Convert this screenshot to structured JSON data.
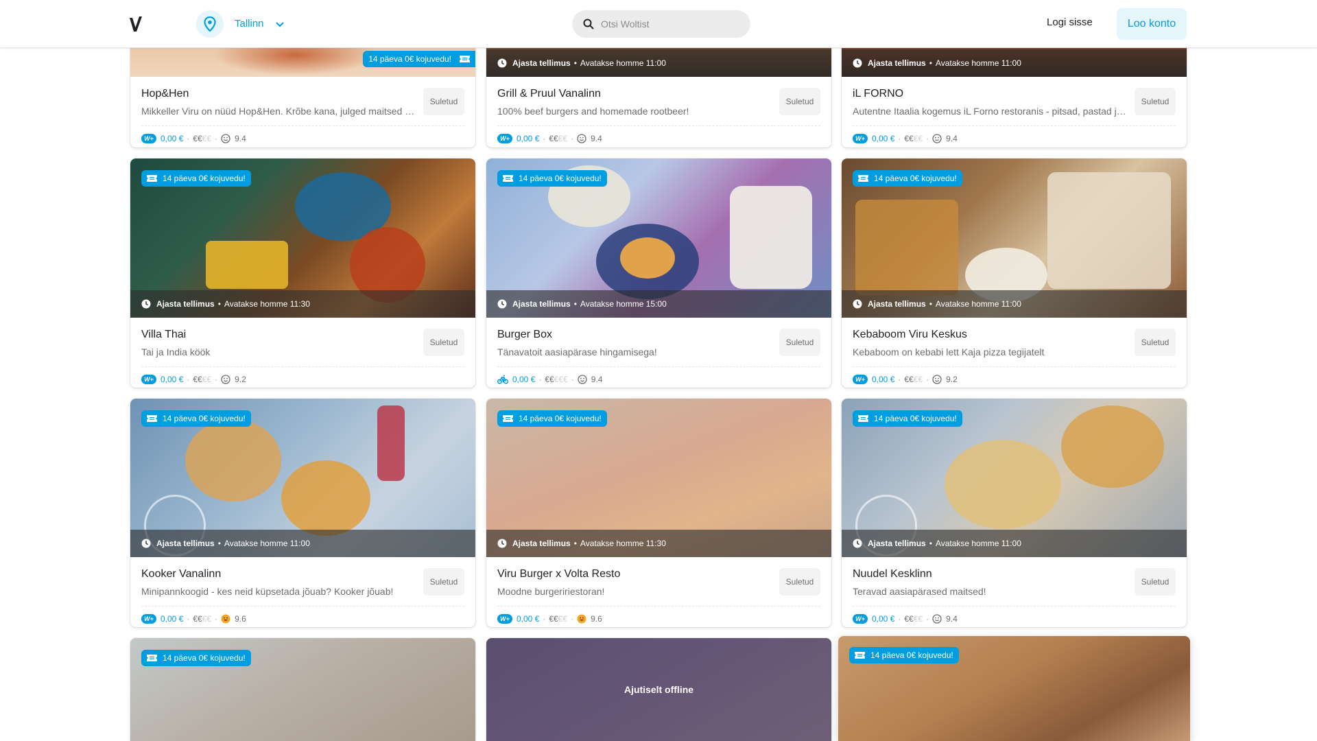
{
  "header": {
    "location": "Tallinn",
    "search_placeholder": "Otsi Woltist",
    "login_label": "Logi sisse",
    "signup_label": "Loo konto"
  },
  "colors": {
    "accent": "#009de0",
    "accent_light": "#e5f5fc",
    "text": "#202125",
    "muted": "#6d6d6d"
  },
  "icons": [
    "wolt-logo-icon",
    "location-pin-icon",
    "chevron-down-icon",
    "search-icon",
    "clock-icon",
    "ticket-icon",
    "wolt-plus-icon",
    "bike-icon",
    "smile-icon"
  ],
  "common": {
    "closed_label": "Suletud",
    "promo_label": "14 päeva 0€ kojuvedu!",
    "schedule_label": "Ajasta tellimus",
    "wolt_plus_label": "W+",
    "fee": "0,00 €",
    "price_on": "€€",
    "price_off": "€€",
    "price_off_3": "€€€",
    "offline_label": "Ajutiselt offline"
  },
  "restaurants": [
    {
      "name": "Hop&Hen",
      "desc": "Mikkeller Viru on nüüd Hop&Hen. Krõbe kana, julged maitsed ja Mikkelleri joogid",
      "rating": "9.4",
      "opens": ""
    },
    {
      "name": "Grill & Pruul Vanalinn",
      "desc": "100% beef burgers and homemade rootbeer!",
      "rating": "9.4",
      "opens": "Avatakse homme 11:00"
    },
    {
      "name": "iL FORNO",
      "desc": "Autentne Itaalia kogemus iL Forno restoranis - pitsad, pastad ja palju muud",
      "rating": "9.4",
      "opens": "Avatakse homme 11:00"
    },
    {
      "name": "Villa Thai",
      "desc": "Tai ja India köök",
      "rating": "9.2",
      "opens": "Avatakse homme 11:30"
    },
    {
      "name": "Burger Box",
      "desc": "Tänavatoit aasiapärase hingamisega!",
      "rating": "9.4",
      "opens": "Avatakse homme 15:00"
    },
    {
      "name": "Kebaboom Viru Keskus",
      "desc": "Kebaboom on kebabi lett Kaja pizza tegijatelt",
      "rating": "9.2",
      "opens": "Avatakse homme 11:00"
    },
    {
      "name": "Kooker Vanalinn",
      "desc": "Minipannkoogid - kes neid küpsetada jõuab? Kooker jõuab!",
      "rating": "9.6",
      "opens": "Avatakse homme 11:00"
    },
    {
      "name": "Viru Burger x Volta Resto",
      "desc": "Moodne burgeririestoran!",
      "rating": "9.6",
      "opens": "Avatakse homme 11:30"
    },
    {
      "name": "Nuudel Kesklinn",
      "desc": "Teravad aasiapärased maitsed!",
      "rating": "9.4",
      "opens": "Avatakse homme 11:00"
    }
  ]
}
